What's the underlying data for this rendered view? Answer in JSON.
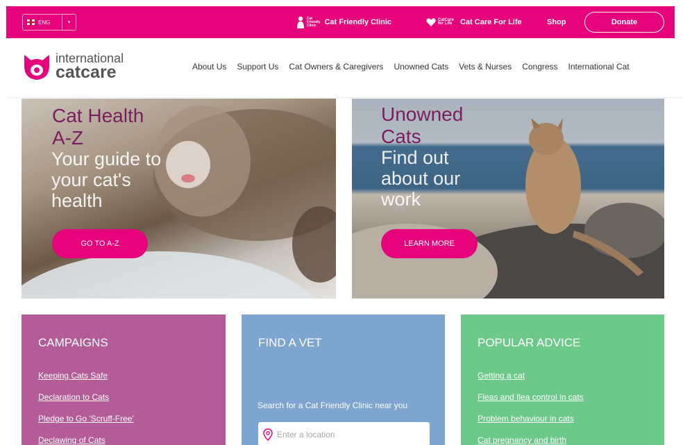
{
  "topbar": {
    "language": "ENG",
    "cat_friendly_clinic": "Cat Friendly Clinic",
    "cfc_logo_text": [
      "Cat",
      "Friendly",
      "Clinic"
    ],
    "cat_care_for_life": "Cat Care For Life",
    "ccfl_logo_text": "CatCare for Life",
    "shop": "Shop",
    "donate": "Donate"
  },
  "header": {
    "logo_line1": "international",
    "logo_line2": "catcare",
    "nav": [
      "About Us",
      "Support Us",
      "Cat Owners & Caregivers",
      "Unowned Cats",
      "Vets & Nurses",
      "Congress",
      "International Cat"
    ]
  },
  "hero_left": {
    "title_line1": "Cat Health",
    "title_line2": "A-Z",
    "subtitle_line1": "Your guide to",
    "subtitle_line2": "your cat's",
    "subtitle_line3": "health",
    "button": "GO TO A-Z"
  },
  "hero_right": {
    "title_line1": "Unowned",
    "title_line2": "Cats",
    "subtitle_line1": "Find out",
    "subtitle_line2": "about our",
    "subtitle_line3": "work",
    "button": "LEARN MORE"
  },
  "campaigns": {
    "title": "CAMPAIGNS",
    "links": [
      "Keeping Cats Safe",
      "Declaration to Cats",
      "Pledge to Go 'Scruff-Free'",
      "Declawing of Cats"
    ]
  },
  "find_vet": {
    "title": "FIND A VET",
    "label": "Search for a Cat Friendly Clinic near you",
    "placeholder": "Enter a location"
  },
  "advice": {
    "title": "POPULAR ADVICE",
    "links": [
      "Getting a cat",
      "Fleas and flea control in cats",
      "Problem behaviour in cats",
      "Cat pregnancy and birth"
    ]
  },
  "colors": {
    "brand_pink": "#e5027b",
    "campaigns_bg": "#b45c97",
    "vet_bg": "#7ea5d0",
    "advice_bg": "#6dc98a",
    "title_purple": "#7b1e5d"
  }
}
